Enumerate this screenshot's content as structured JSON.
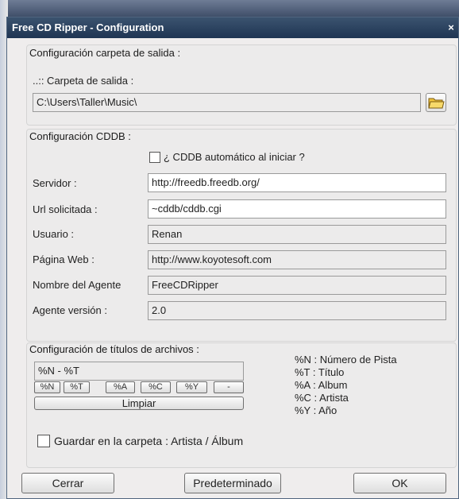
{
  "window": {
    "title": "Free CD Ripper - Configuration",
    "close_glyph": "×"
  },
  "output": {
    "group_title": "Configuración carpeta de salida :",
    "folder_label": "..:: Carpeta de salida :",
    "folder_value": "C:\\Users\\Taller\\Music\\"
  },
  "cddb": {
    "group_title": "Configuración CDDB :",
    "auto_label": "¿ CDDB automático al iniciar ?",
    "auto_checked": false,
    "server_label": "Servidor :",
    "server_value": "http://freedb.freedb.org/",
    "url_label": "Url solicitada :",
    "url_value": "~cddb/cddb.cgi",
    "user_label": "Usuario :",
    "user_value": "Renan",
    "web_label": "Página Web :",
    "web_value": "http://www.koyotesoft.com",
    "agent_label": "Nombre del Agente",
    "agent_value": "FreeCDRipper",
    "version_label": "Agente versión :",
    "version_value": "2.0"
  },
  "titles": {
    "group_title": "Configuración de títulos de archivos :",
    "pattern_value": "%N - %T",
    "tokens": [
      "%N",
      "%T",
      "%A",
      "%C",
      "%Y",
      "-"
    ],
    "clear_label": "Limpiar",
    "legend": [
      "%N : Número de Pista",
      "%T : Título",
      "%A : Album",
      "%C : Artista",
      "%Y : Año"
    ],
    "save_label": "Guardar en la carpeta : Artista / Álbum",
    "save_checked": false
  },
  "footer": {
    "close_label": "Cerrar",
    "default_label": "Predeterminado",
    "ok_label": "OK"
  }
}
